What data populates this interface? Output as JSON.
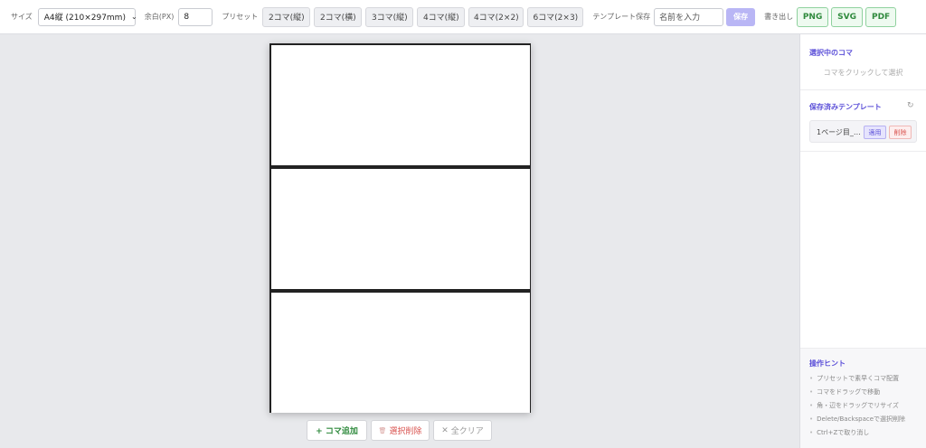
{
  "toolbar": {
    "size_label": "サイズ",
    "size_value": "A4縦 (210×297mm)",
    "margin_label": "余白(PX)",
    "margin_value": "8",
    "preset_label": "プリセット",
    "presets": [
      "2コマ(縦)",
      "2コマ(横)",
      "3コマ(縦)",
      "4コマ(縦)",
      "4コマ(2×2)",
      "6コマ(2×3)"
    ],
    "template_save_label": "テンプレート保存",
    "template_name_placeholder": "名前を入力",
    "save_label": "保存",
    "export_label": "書き出し",
    "export_png": "PNG",
    "export_svg": "SVG",
    "export_pdf": "PDF"
  },
  "canvas": {
    "panel_count": 3
  },
  "actions": {
    "add_panel": "+ コマ追加",
    "delete_selected": "選択削除",
    "delete_selected_icon": "trash-icon",
    "clear_all": "全クリア",
    "clear_all_icon": "close-icon"
  },
  "sidebar": {
    "selected_title": "選択中のコマ",
    "selected_empty": "コマをクリックして選択",
    "templates_title": "保存済みテンプレート",
    "refresh_icon": "refresh-icon",
    "templates": [
      {
        "name": "1ページ目_…",
        "apply": "適用",
        "delete": "削除"
      }
    ],
    "hints_title": "操作ヒント",
    "hints": [
      "プリセットで素早くコマ配置",
      "コマをドラッグで移動",
      "角・辺をドラッグでリサイズ",
      "Delete/Backspaceで選択削除",
      "Ctrl+Zで取り消し"
    ]
  },
  "colors": {
    "accent": "#5b4fd8",
    "save_button": "#b9b6f5",
    "export_green": "#2f8a3d",
    "delete_red": "#d9534f"
  }
}
